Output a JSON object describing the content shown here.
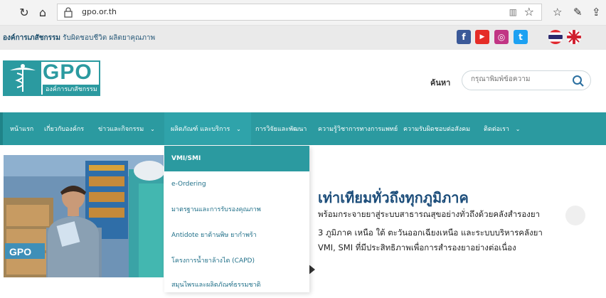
{
  "browser": {
    "url": "gpo.or.th",
    "reader_glyph": "▥",
    "star_glyph": "☆"
  },
  "topstrip": {
    "org_name": "องค์การเภสัชกรรม",
    "slogan": "รับผิดชอบชีวิต ผลิตยาคุณภาพ",
    "social": [
      {
        "name": "facebook",
        "glyph": "f",
        "color": "#3b5998"
      },
      {
        "name": "youtube",
        "glyph": "▶",
        "color": "#e52d27"
      },
      {
        "name": "instagram",
        "glyph": "◎",
        "color": "#c13584"
      },
      {
        "name": "twitter",
        "glyph": "t",
        "color": "#1da1f2"
      }
    ]
  },
  "header": {
    "logo_text": "GPO",
    "logo_sub": "องค์การเภสัชกรรม",
    "search_label": "ค้นหา",
    "search_placeholder": "กรุณาพิมพ์ข้อความ"
  },
  "nav": {
    "items": [
      {
        "label": "หน้าแรก",
        "chevron": ""
      },
      {
        "label": "เกี่ยวกับองค์กร",
        "chevron": ""
      },
      {
        "label": "ข่าวและกิจกรรม",
        "chevron": "⌄"
      },
      {
        "label": "ผลิตภัณฑ์ และบริการ",
        "chevron": "⌄"
      },
      {
        "label": "การวิจัยและพัฒนา",
        "chevron": ""
      },
      {
        "label": "ความรู้วิชาการทางการแพทย์",
        "chevron": ""
      },
      {
        "label": "ความรับผิดชอบต่อสังคม",
        "chevron": ""
      },
      {
        "label": "ติดต่อเรา",
        "chevron": "⌄"
      }
    ]
  },
  "dropdown": {
    "items": [
      {
        "label": "VMI/SMI"
      },
      {
        "label": "e-Ordering"
      },
      {
        "label": "มาตรฐานและการรับรองคุณภาพ"
      },
      {
        "label": "Antidote ยาต้านพิษ ยากำพร้า"
      },
      {
        "label": "โครงการน้ำยาล้างไต (CAPD)"
      },
      {
        "label": "สมุนไพรและผลิตภัณฑ์ธรรมชาติ"
      }
    ]
  },
  "hero": {
    "title": "เท่าเทียมทั่วถึงทุกภูมิภาค",
    "lines": [
      "พร้อมกระจายยาสู่ระบบสาธารณสุขอย่างทั่วถึงด้วยคลังสำรองยา",
      "3 ภูมิภาค เหนือ ใต้ ตะวันออกเฉียงเหนือ และระบบบริหารคลังยา",
      "VMI, SMI ที่มีประสิทธิภาพเพื่อการสำรองยาอย่างต่อเนื่อง"
    ],
    "photo_box_label": "GPO"
  }
}
